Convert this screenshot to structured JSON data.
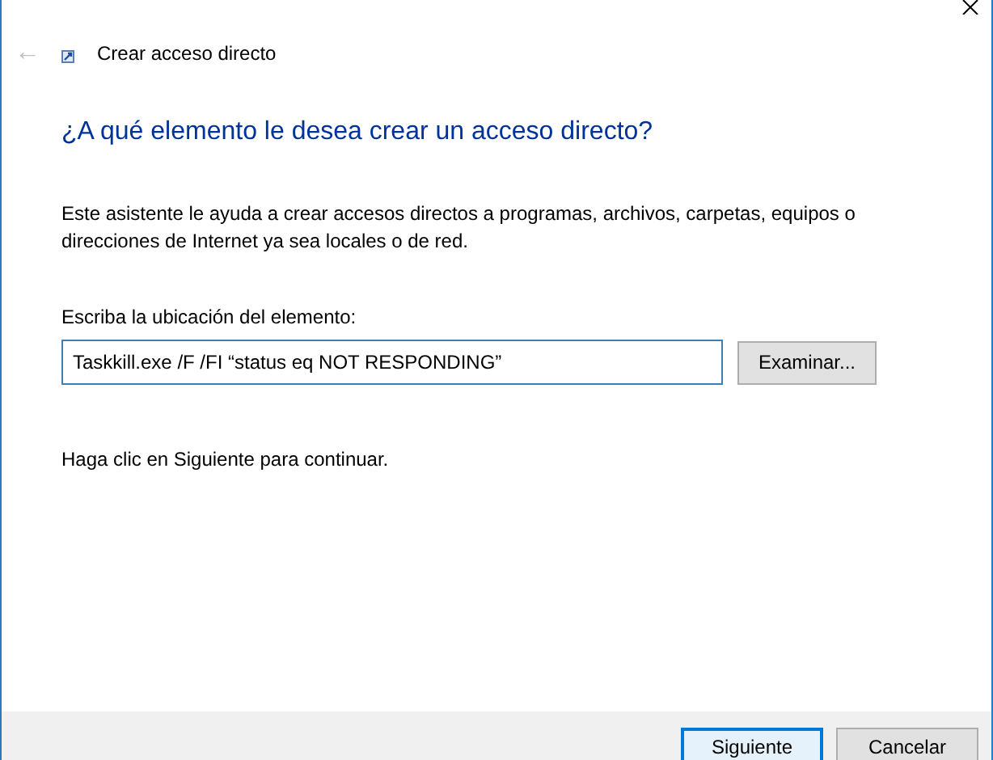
{
  "window": {
    "title": "Crear acceso directo",
    "back": "←"
  },
  "heading": "¿A qué elemento le desea crear un acceso directo?",
  "description": "Este asistente le ayuda a crear accesos directos a programas, archivos, carpetas, equipos o direcciones de Internet ya sea locales o de red.",
  "location": {
    "label": "Escriba la ubicación del elemento:",
    "value": "Taskkill.exe /F /FI “status eq NOT RESPONDING”",
    "browse_button": "Examinar..."
  },
  "hint": "Haga clic en Siguiente para continuar.",
  "buttons": [
    {
      "label": "Siguiente",
      "default": true
    },
    {
      "label": "Cancelar",
      "default": false
    }
  ]
}
